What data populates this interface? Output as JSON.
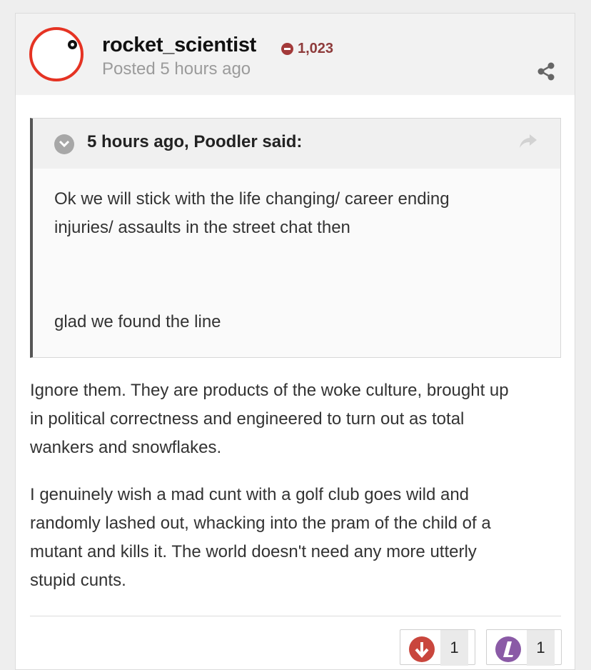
{
  "author": {
    "username": "rocket_scientist",
    "reputation": "1,023",
    "posted": "Posted 5 hours ago",
    "colors": {
      "avatar_ring": "#e53323",
      "reputation": "#8e3b3b"
    }
  },
  "quote": {
    "citation": "5 hours ago, Poodler said:",
    "lines": [
      "Ok we will stick with the life changing/ career ending",
      "injuries/ assaults in the street chat then",
      "glad we found the line"
    ]
  },
  "body": {
    "paragraph1_lines": [
      "Ignore them. They are products of the woke culture, brought up",
      "in political correctness and engineered to turn out as total",
      "wankers and snowflakes."
    ],
    "paragraph2_lines": [
      "I genuinely wish a mad cunt with a golf club goes wild and",
      "randomly lashed out, whacking into the pram of the child of a",
      "mutant and kills it. The world doesn't need any more utterly",
      "stupid cunts."
    ]
  },
  "reactions": [
    {
      "icon": "downvote-icon",
      "count": "1",
      "color": "#c9463d"
    },
    {
      "icon": "lol-icon",
      "count": "1",
      "color": "#8a5aa6"
    }
  ],
  "icons": {
    "share": "share-icon",
    "quote_toggle": "chevron-down-icon",
    "quote_share": "reply-arrow-icon"
  }
}
